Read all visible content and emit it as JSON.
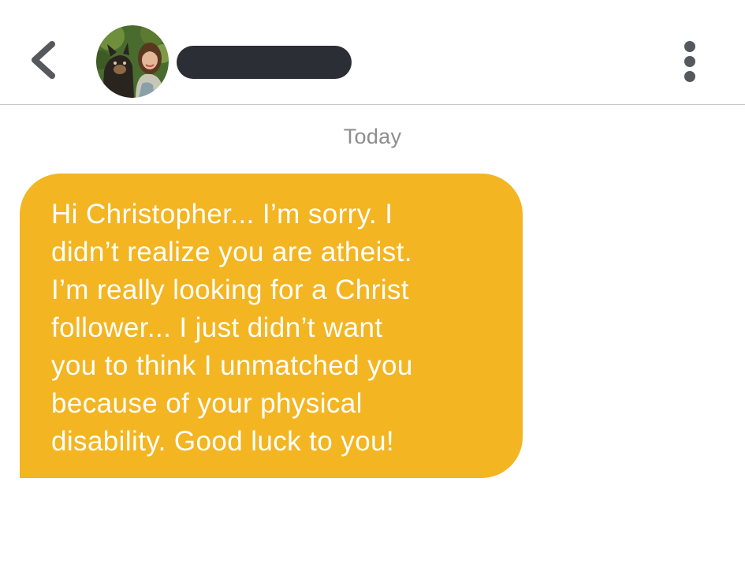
{
  "colors": {
    "accent": "#f3b521",
    "bubble_text": "#ffffff",
    "divider": "#c8c8c8",
    "date_text": "#8d8d8d",
    "redaction": "#2b2f35",
    "menu_icon": "#55585c"
  },
  "header": {
    "back_icon": "chevron-left-icon",
    "avatar_icon": "profile-photo-woman-with-dog",
    "menu_icon": "vertical-ellipsis-icon"
  },
  "chat": {
    "date_label": "Today",
    "messages": [
      {
        "direction": "incoming",
        "text": "Hi Christopher... I’m sorry. I\ndidn’t realize you are atheist.\nI’m really looking for a Christ\nfollower... I just didn’t want\nyou to think I unmatched you\nbecause of your physical\ndisability. Good luck to you!"
      }
    ]
  }
}
